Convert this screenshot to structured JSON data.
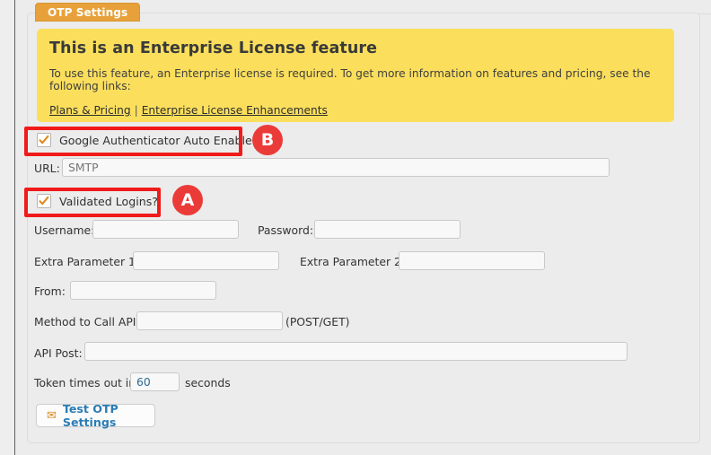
{
  "tab": {
    "label": "OTP Settings"
  },
  "notice": {
    "heading": "This is an Enterprise License feature",
    "body": "To use this feature, an Enterprise license is required. To get more information on features and pricing, see the following links:",
    "link1": "Plans & Pricing",
    "separator": "|",
    "link2": "Enterprise License Enhancements",
    "bg_color": "#fbdf5c"
  },
  "checkboxes": {
    "google_auth": {
      "label": "Google Authenticator Auto Enable",
      "checked": true
    },
    "validated_logins": {
      "label": "Validated Logins?",
      "checked": true
    }
  },
  "annotations": {
    "a": {
      "letter": "A",
      "color": "#eb3b38"
    },
    "b": {
      "letter": "B",
      "color": "#eb3b38"
    }
  },
  "fields": {
    "url": {
      "label": "URL:",
      "value": "",
      "placeholder": "SMTP"
    },
    "username": {
      "label": "Username:",
      "value": ""
    },
    "password": {
      "label": "Password:",
      "value": ""
    },
    "extra_param_1": {
      "label": "Extra Parameter 1:",
      "value": ""
    },
    "extra_param_2": {
      "label": "Extra Parameter 2:",
      "value": ""
    },
    "from": {
      "label": "From:",
      "value": ""
    },
    "method_to_call_api": {
      "label": "Method to Call API:",
      "value": "",
      "hint": "(POST/GET)"
    },
    "api_post": {
      "label": "API Post:",
      "value": ""
    },
    "token_timeout": {
      "label_before": "Token times out in",
      "value": "60",
      "label_after": "seconds"
    }
  },
  "buttons": {
    "test_otp": {
      "label": "Test OTP Settings",
      "icon": "envelope-icon"
    }
  }
}
